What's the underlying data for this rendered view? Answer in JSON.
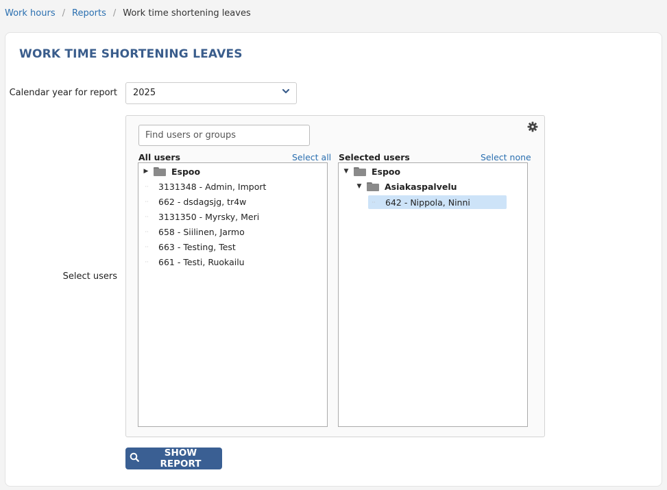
{
  "breadcrumb": {
    "items": [
      "Work hours",
      "Reports"
    ],
    "separator": "/",
    "current": "Work time shortening leaves"
  },
  "page": {
    "title": "WORK TIME SHORTENING LEAVES"
  },
  "form": {
    "year_label": "Calendar year for report",
    "year_value": "2025",
    "users_label": "Select users",
    "search_placeholder": "Find users or groups",
    "submit_label": "SHOW REPORT"
  },
  "all_users": {
    "header": "All users",
    "action": "Select all",
    "group": "Espoo",
    "items": [
      "3131348 - Admin, Import",
      "662 - dsdagsjg, tr4w",
      "3131350 - Myrsky, Meri",
      "658 - Siilinen, Jarmo",
      "663 - Testing, Test",
      "661 - Testi, Ruokailu"
    ]
  },
  "selected_users": {
    "header": "Selected users",
    "action": "Select none",
    "group": "Espoo",
    "subgroup": "Asiakaspalvelu",
    "items": [
      "642 - Nippola, Ninni"
    ]
  },
  "colors": {
    "accent": "#3a5f93",
    "link": "#2a6fb0",
    "title": "#3a5d8c",
    "selection": "#cde3f8"
  },
  "icons": [
    "chevron-down-icon",
    "gear-icon",
    "caret-right-icon",
    "caret-down-icon",
    "folder-icon",
    "search-icon"
  ]
}
